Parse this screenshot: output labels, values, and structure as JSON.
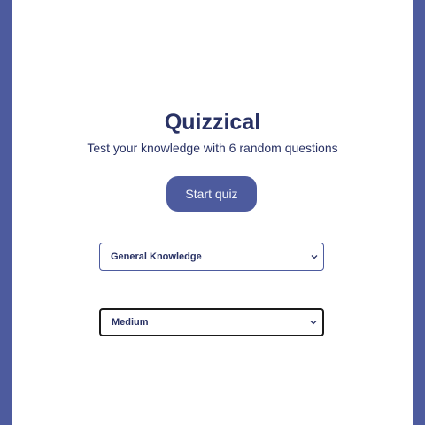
{
  "app": {
    "title": "Quizzical",
    "subtitle": "Test your knowledge with 6 random questions"
  },
  "actions": {
    "start_label": "Start quiz"
  },
  "selects": {
    "category": "General Knowledge",
    "difficulty": "Medium"
  },
  "colors": {
    "background": "#4d5b9e",
    "panel": "#ffffff",
    "text": "#293264",
    "button": "#4d5b9e",
    "button_text": "#f5f7fb"
  },
  "icons": {
    "select_arrow": "chevron-down-icon"
  }
}
